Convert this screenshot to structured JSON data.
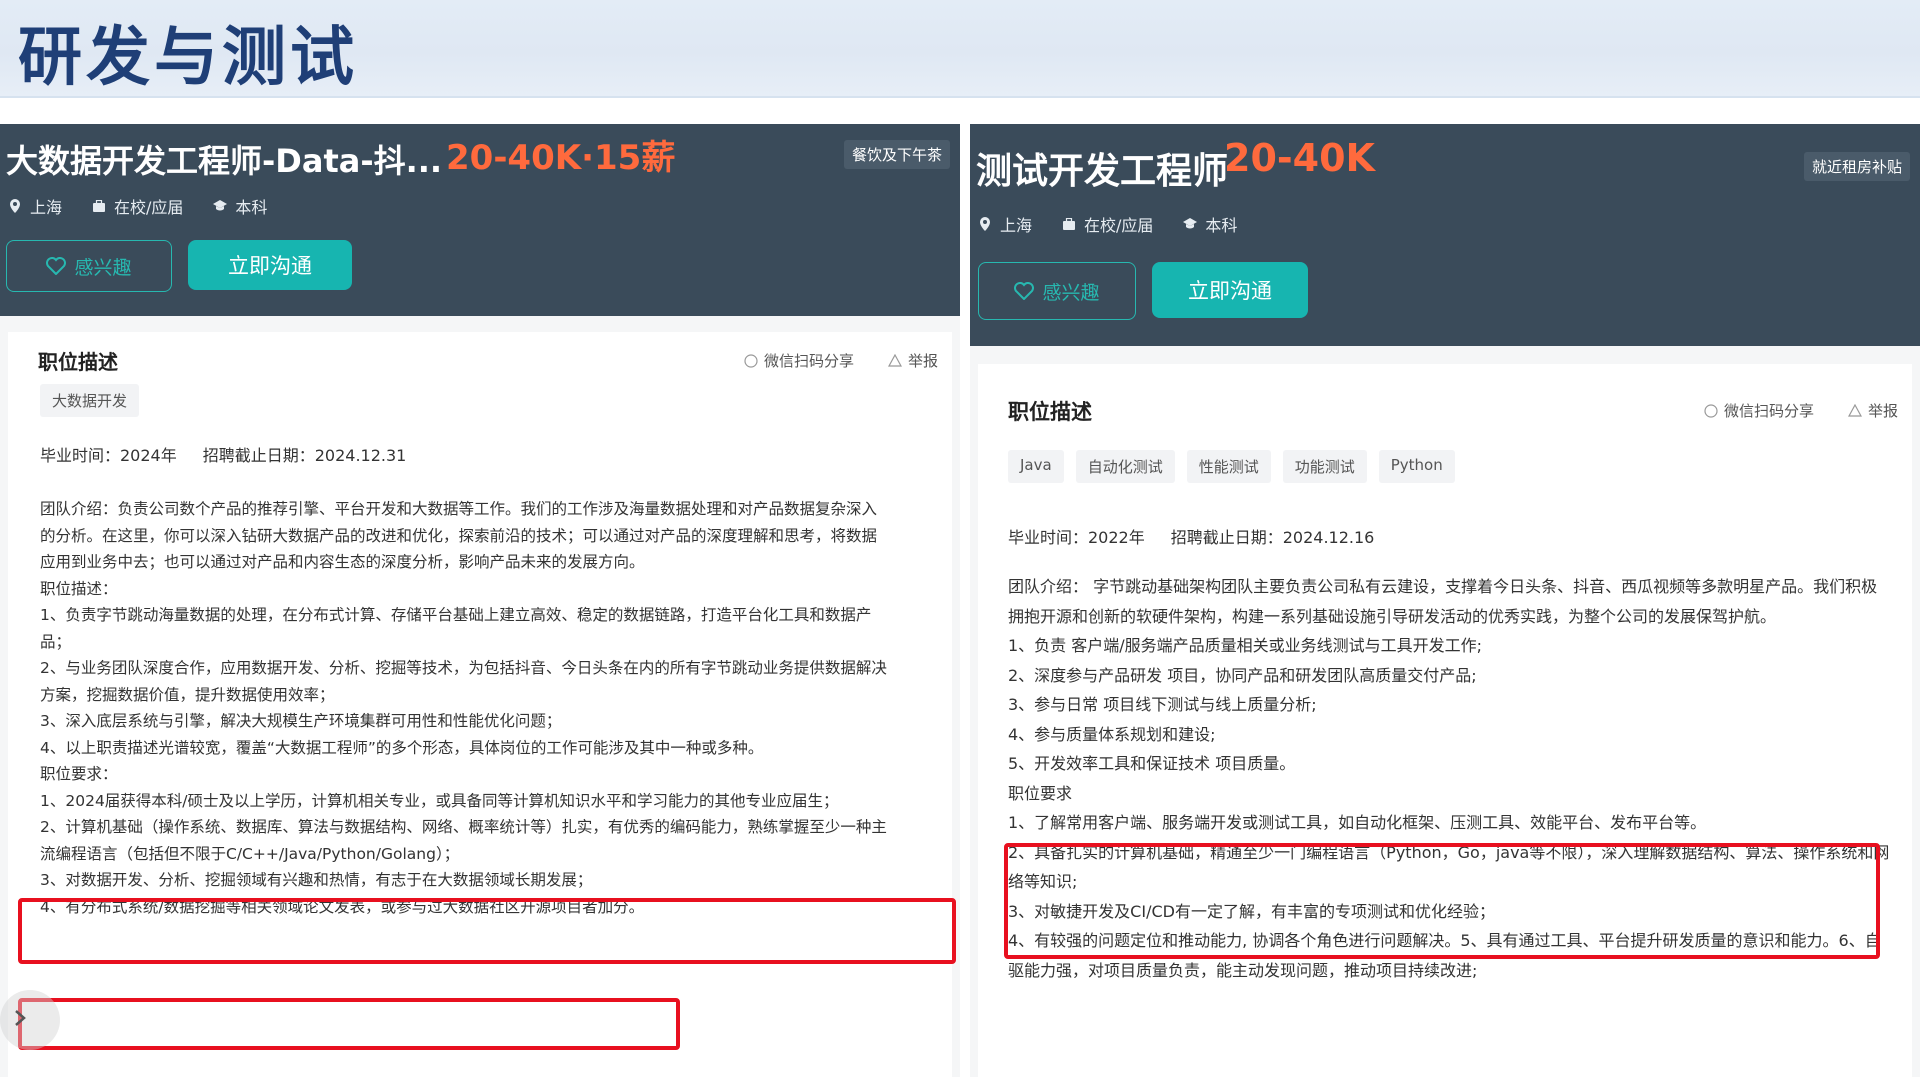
{
  "slide_title": "研发与测试",
  "left": {
    "job_title": "大数据开发工程师-Data-抖...",
    "salary": "20-40K·15薪",
    "perk": "餐饮及下午茶",
    "meta": [
      "上海",
      "在校/应届",
      "本科"
    ],
    "interest_label": "感兴趣",
    "chat_label": "立即沟通",
    "section_title": "职位描述",
    "share_label": "微信扫码分享",
    "report_label": "举报",
    "tags": [
      "大数据开发"
    ],
    "graduation": "毕业时间：2024年",
    "deadline": "招聘截止日期：2024.12.31",
    "lines": [
      "团队介绍：负责公司数个产品的推荐引擎、平台开发和大数据等工作。我们的工作涉及海量数据处理和对产品数据复杂深入",
      "的分析。在这里，你可以深入钻研大数据产品的改进和优化，探索前沿的技术；可以通过对产品的深度理解和思考，将数据",
      "应用到业务中去；也可以通过对产品和内容生态的深度分析，影响产品未来的发展方向。",
      "职位描述：",
      "1、负责字节跳动海量数据的处理，在分布式计算、存储平台基础上建立高效、稳定的数据链路，打造平台化工具和数据产",
      "品；",
      "2、与业务团队深度合作，应用数据开发、分析、挖掘等技术，为包括抖音、今日头条在内的所有字节跳动业务提供数据解决",
      "方案，挖掘数据价值，提升数据使用效率；",
      "3、深入底层系统与引擎，解决大规模生产环境集群可用性和性能优化问题；",
      "4、以上职责描述光谱较宽，覆盖“大数据工程师”的多个形态，具体岗位的工作可能涉及其中一种或多种。",
      "职位要求：",
      "1、2024届获得本科/硕士及以上学历，计算机相关专业，或具备同等计算机知识水平和学习能力的其他专业应届生；",
      "2、计算机基础（操作系统、数据库、算法与数据结构、网络、概率统计等）扎实，有优秀的编码能力，熟练掌握至少一种主",
      "流编程语言（包括但不限于C/C++/Java/Python/Golang）；",
      "3、对数据开发、分析、挖掘领域有兴趣和热情，有志于在大数据领域长期发展；",
      "4、有分布式系统/数据挖掘等相关领域论文发表，或参与过大数据社区开源项目者加分。"
    ]
  },
  "right": {
    "job_title": "测试开发工程师",
    "salary": "20-40K",
    "perk": "就近租房补贴",
    "meta": [
      "上海",
      "在校/应届",
      "本科"
    ],
    "interest_label": "感兴趣",
    "chat_label": "立即沟通",
    "section_title": "职位描述",
    "share_label": "微信扫码分享",
    "report_label": "举报",
    "tags": [
      "Java",
      "自动化测试",
      "性能测试",
      "功能测试",
      "Python"
    ],
    "graduation": "毕业时间：2022年",
    "deadline": "招聘截止日期：2024.12.16",
    "lines": [
      "团队介绍： 字节跳动基础架构团队主要负责公司私有云建设，支撑着今日头条、抖音、西瓜视频等多款明星产品。我们积极",
      "拥抱开源和创新的软硬件架构，构建一系列基础设施引导研发活动的优秀实践，为整个公司的发展保驾护航。",
      "1、负责 客户端/服务端产品质量相关或业务线测试与工具开发工作;",
      "2、深度参与产品研发 项目，协同产品和研发团队高质量交付产品;",
      "3、参与日常 项目线下测试与线上质量分析;",
      "4、参与质量体系规划和建设;",
      "5、开发效率工具和保证技术 项目质量。",
      "职位要求",
      "1、了解常用客户端、服务端开发或测试工具，如自动化框架、压测工具、效能平台、发布平台等。",
      "2、具备扎实的计算机基础，精通至少一门编程语言（Python，Go，java等不限），深入理解数据结构、算法、操作系统和网",
      "络等知识;",
      "3、对敏捷开发及CI/CD有一定了解，有丰富的专项测试和优化经验；",
      "4、有较强的问题定位和推动能力, 协调各个角色进行问题解决。5、具有通过工具、平台提升研发质量的意识和能力。6、自",
      "驱能力强，对项目质量负责，能主动发现问题，推动项目持续改进;"
    ]
  },
  "colors": {
    "hero_bg": "#3a4b5a",
    "accent": "#17b5b0",
    "salary": "#ff6a3d",
    "highlight": "#e8101f",
    "title": "#1f3f77"
  }
}
